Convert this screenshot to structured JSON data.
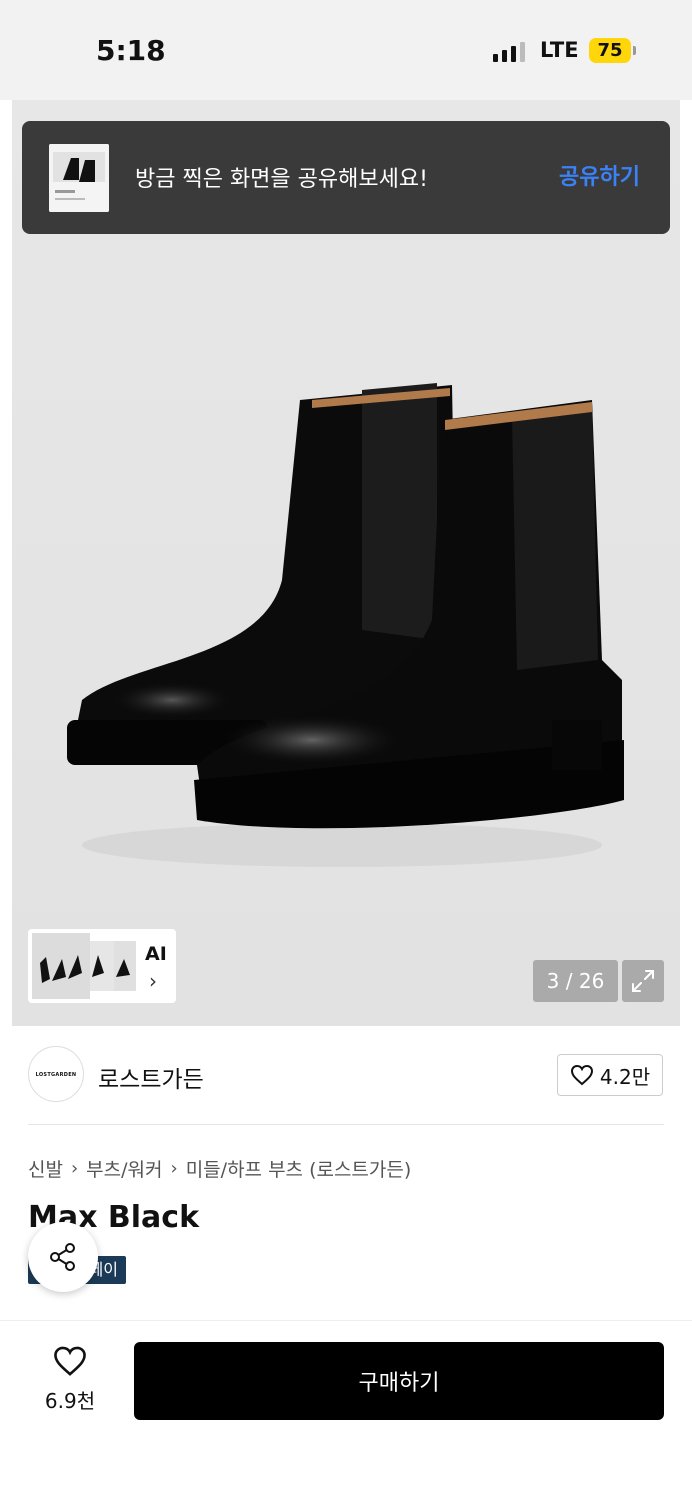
{
  "status_bar": {
    "time": "5:18",
    "network": "LTE",
    "battery": "75"
  },
  "toast": {
    "message": "방금 찍은 화면을 공유해보세요!",
    "action": "공유하기"
  },
  "gallery": {
    "counter": "3 / 26",
    "ai_label": "AI",
    "ai_chevron": "›"
  },
  "brand": {
    "logo_text": "LOSTGARDEN",
    "name": "로스트가든",
    "likes": "4.2만"
  },
  "breadcrumb": [
    "신발",
    "부츠/워커",
    "미들/하프 부츠 (로스트가든)"
  ],
  "breadcrumb_separator": "›",
  "product": {
    "title": "Max Black",
    "badge": "페이"
  },
  "bottom_bar": {
    "wish_count": "6.9천",
    "buy_label": "구매하기"
  },
  "icons": [
    "signal-icon",
    "battery-icon",
    "expand-icon",
    "heart-icon",
    "share-icon",
    "chevron-right-icon"
  ]
}
